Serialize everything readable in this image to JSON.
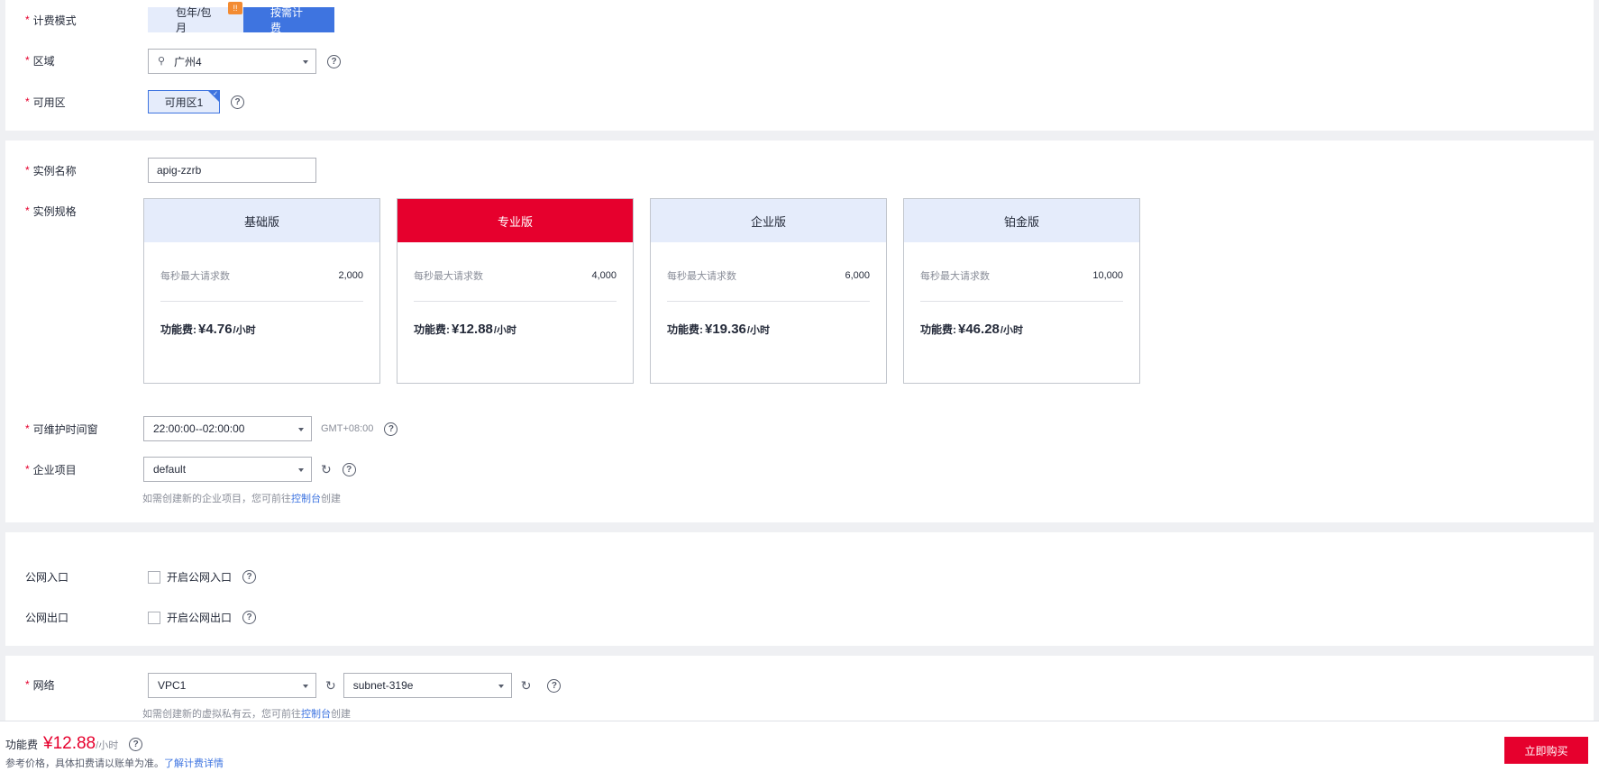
{
  "billing": {
    "label": "计费模式",
    "options": [
      "包年/包月",
      "按需计费"
    ],
    "selected": "按需计费",
    "badge": "!!"
  },
  "region": {
    "label": "区域",
    "value": "广州4"
  },
  "az": {
    "label": "可用区",
    "value": "可用区1"
  },
  "instance": {
    "name_label": "实例名称",
    "name_value": "apig-zzrb",
    "spec_label": "实例规格"
  },
  "specs": [
    {
      "title": "基础版",
      "key": "每秒最大请求数",
      "val": "2,000",
      "price_label": "功能费:",
      "price": "¥4.76",
      "unit": "/小时"
    },
    {
      "title": "专业版",
      "key": "每秒最大请求数",
      "val": "4,000",
      "price_label": "功能费:",
      "price": "¥12.88",
      "unit": "/小时"
    },
    {
      "title": "企业版",
      "key": "每秒最大请求数",
      "val": "6,000",
      "price_label": "功能费:",
      "price": "¥19.36",
      "unit": "/小时"
    },
    {
      "title": "铂金版",
      "key": "每秒最大请求数",
      "val": "10,000",
      "price_label": "功能费:",
      "price": "¥46.28",
      "unit": "/小时"
    }
  ],
  "maintenance": {
    "label": "可维护时间窗",
    "value": "22:00:00--02:00:00",
    "tz": "GMT+08:00"
  },
  "enterprise": {
    "label": "企业项目",
    "value": "default",
    "hint_pre": "如需创建新的企业项目，您可前往",
    "hint_link": "控制台",
    "hint_post": "创建"
  },
  "public_in": {
    "label": "公网入口",
    "check_label": "开启公网入口"
  },
  "public_out": {
    "label": "公网出口",
    "check_label": "开启公网出口"
  },
  "network": {
    "label": "网络",
    "vpc": "VPC1",
    "subnet": "subnet-319e",
    "hint_pre": "如需创建新的虚拟私有云，您可前往",
    "hint_link": "控制台",
    "hint_post": "创建"
  },
  "footer": {
    "fee_label": "功能费",
    "fee_value": "¥12.88",
    "fee_unit": "/小时",
    "note": "参考价格，具体扣费请以账单为准。",
    "note_link": "了解计费详情",
    "buy": "立即购买"
  },
  "colors": {
    "primary": "#3e74e0",
    "danger": "#e6002d",
    "light": "#e5ecfb"
  }
}
